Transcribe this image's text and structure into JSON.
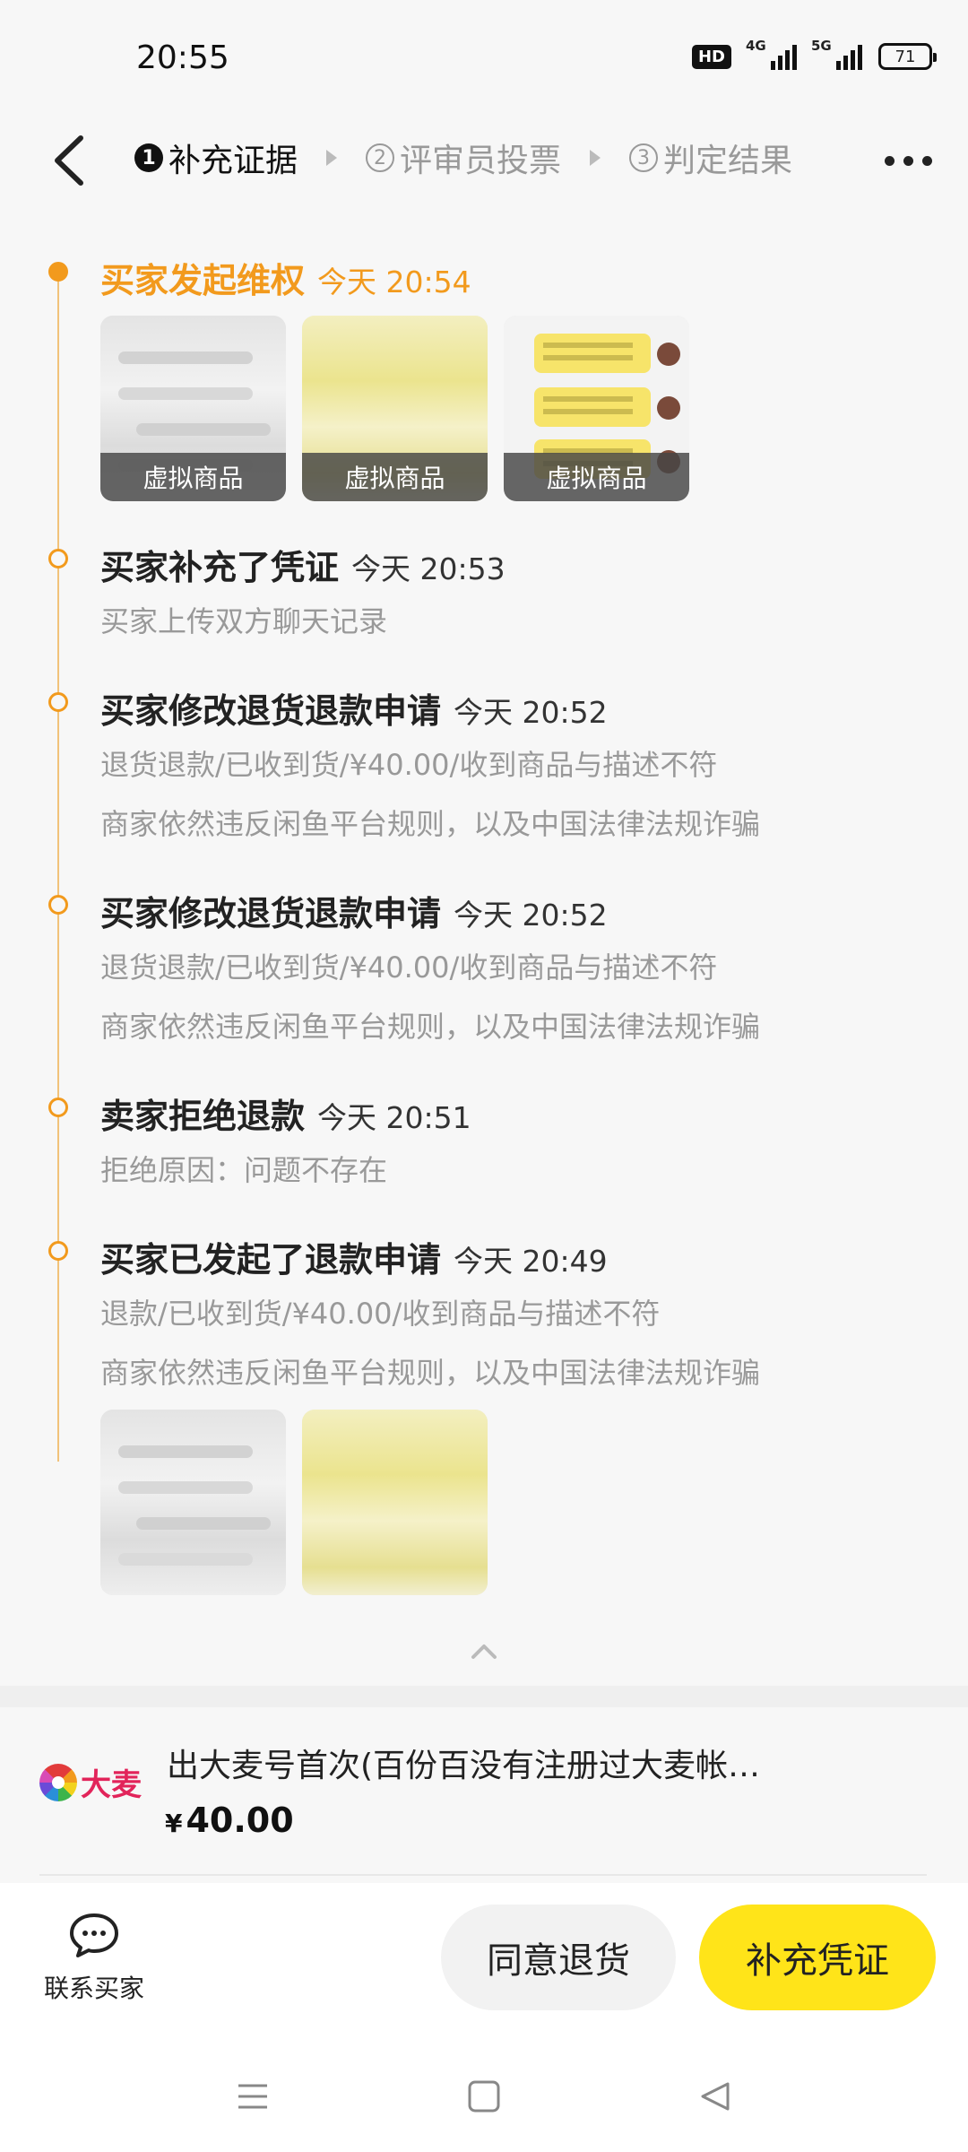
{
  "status_bar": {
    "time": "20:55",
    "hd_badge": "HD",
    "signal1_label": "4G",
    "signal2_label": "5G",
    "battery": "71"
  },
  "header": {
    "steps": [
      {
        "num": "1",
        "label": "补充证据",
        "active": true
      },
      {
        "num": "2",
        "label": "评审员投票",
        "active": false
      },
      {
        "num": "3",
        "label": "判定结果",
        "active": false
      }
    ]
  },
  "timeline": {
    "events": [
      {
        "title": "买家发起维权",
        "time": "今天 20:54",
        "highlight": true,
        "lines": [],
        "thumbnails": [
          {
            "caption": "虚拟商品"
          },
          {
            "caption": "虚拟商品"
          },
          {
            "caption": "虚拟商品"
          }
        ]
      },
      {
        "title": "买家补充了凭证",
        "time": "今天 20:53",
        "lines": [
          "买家上传双方聊天记录"
        ]
      },
      {
        "title": "买家修改退货退款申请",
        "time": "今天 20:52",
        "lines": [
          "退货退款/已收到货/¥40.00/收到商品与描述不符",
          "商家依然违反闲鱼平台规则，以及中国法律法规诈骗"
        ]
      },
      {
        "title": "买家修改退货退款申请",
        "time": "今天 20:52",
        "lines": [
          "退货退款/已收到货/¥40.00/收到商品与描述不符",
          "商家依然违反闲鱼平台规则，以及中国法律法规诈骗"
        ]
      },
      {
        "title": "卖家拒绝退款",
        "time": "今天 20:51",
        "lines": [
          "拒绝原因：问题不存在"
        ]
      },
      {
        "title": "买家已发起了退款申请",
        "time": "今天 20:49",
        "lines": [
          "退款/已收到货/¥40.00/收到商品与描述不符",
          "商家依然违反闲鱼平台规则，以及中国法律法规诈骗"
        ]
      }
    ]
  },
  "product": {
    "brand": "大麦",
    "title": "出大麦号首次(百份百没有注册过大麦帐…",
    "currency": "¥",
    "price": "40.00"
  },
  "actions": {
    "contact_label": "联系买家",
    "agree_label": "同意退货",
    "evidence_label": "补充凭证"
  },
  "colors": {
    "accent_orange": "#f29a1d",
    "primary_yellow": "#ffe419"
  }
}
